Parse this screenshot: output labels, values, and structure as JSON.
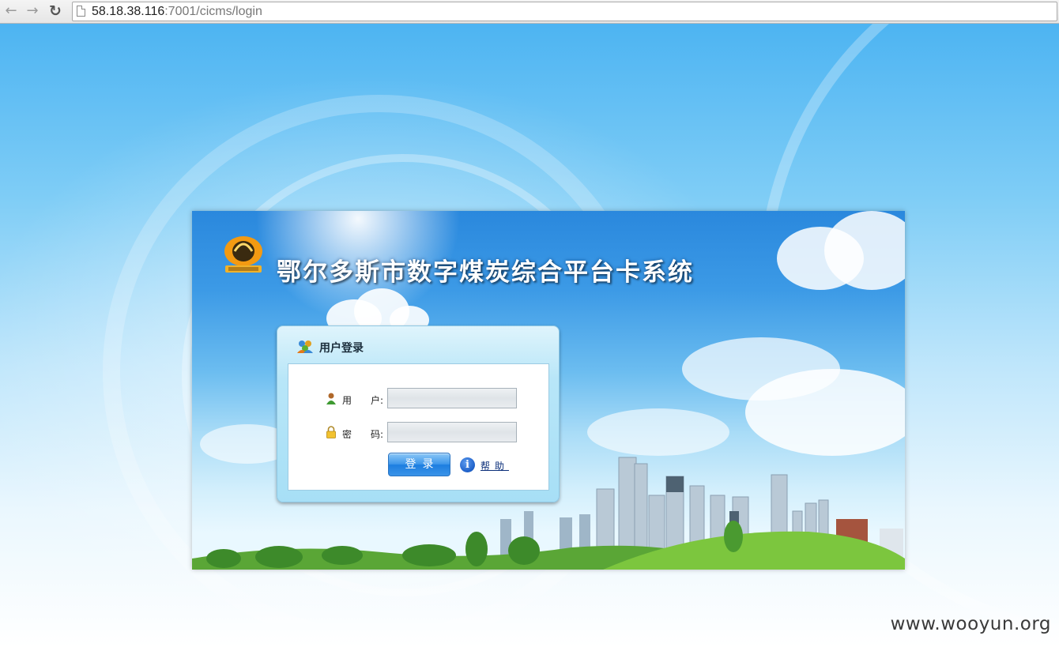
{
  "browser": {
    "back_icon": "arrow-left-icon",
    "forward_icon": "arrow-right-icon",
    "reload_icon": "reload-icon",
    "url_host": "58.18.38.116",
    "url_rest": ":7001/cicms/login"
  },
  "banner": {
    "title": "鄂尔多斯市数字煤炭综合平台卡系统"
  },
  "login": {
    "title": "用户登录",
    "user_label_a": "用",
    "user_label_b": "户:",
    "password_label_a": "密",
    "password_label_b": "码:",
    "username_value": "",
    "password_value": "",
    "submit_label": "登录",
    "help_label": "帮助"
  },
  "watermark": "www.wooyun.org",
  "colors": {
    "sky_top": "#4db4f2",
    "button_blue": "#1d7ee0",
    "help_link": "#0b2f7a"
  }
}
